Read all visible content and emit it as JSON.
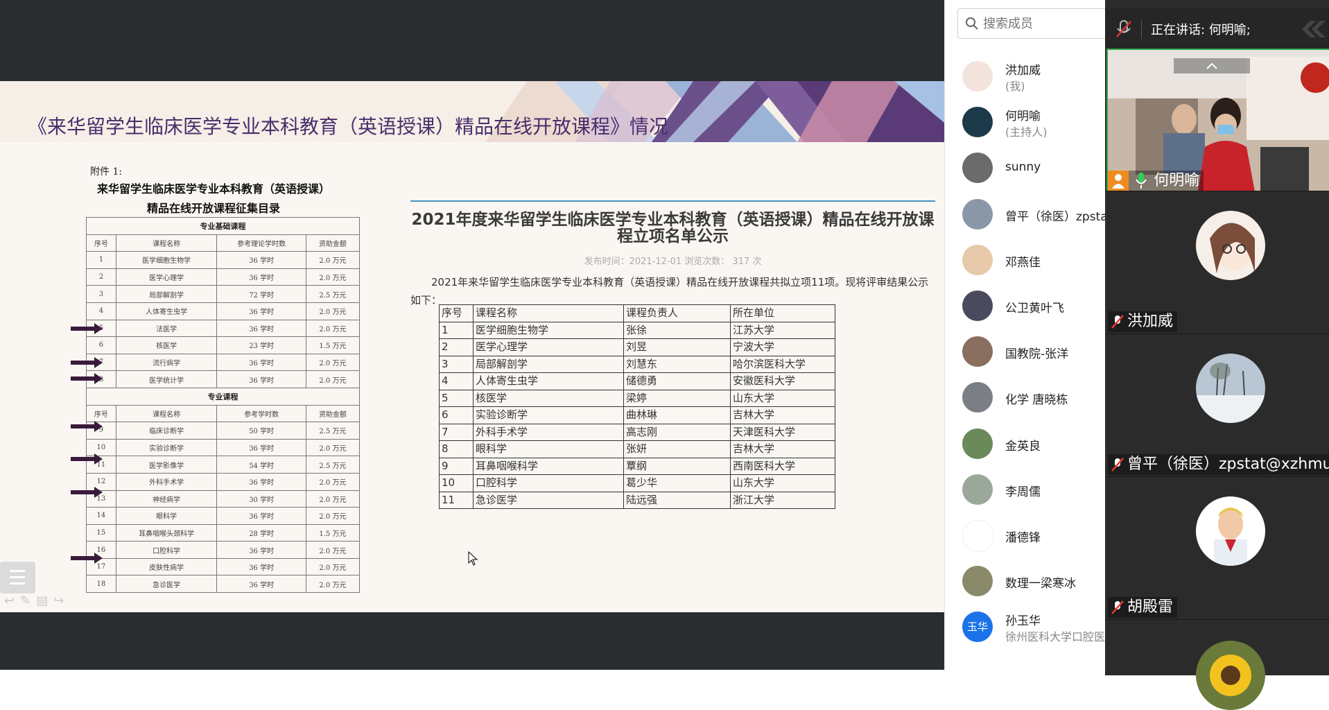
{
  "slide": {
    "title": "《来华留学生临床医学专业本科教育（英语授课）精品在线开放课程》情况"
  },
  "scan": {
    "attachment": "附件 1:",
    "heading1": "来华留学生临床医学专业本科教育（英语授课）",
    "heading2": "精品在线开放课程征集目录",
    "section_basic": "专业基础课程",
    "section_prof": "专业课程",
    "columns": [
      "序号",
      "课程名称",
      "参考理论学时数",
      "资助金额"
    ],
    "basic_rows": [
      [
        "1",
        "医学细胞生物学",
        "36 学时",
        "2.0 万元"
      ],
      [
        "2",
        "医学心理学",
        "36 学时",
        "2.0 万元"
      ],
      [
        "3",
        "局部解剖学",
        "72 学时",
        "2.5 万元"
      ],
      [
        "4",
        "人体寄生虫学",
        "36 学时",
        "2.0 万元"
      ],
      [
        "5",
        "法医学",
        "36 学时",
        "2.0 万元"
      ],
      [
        "6",
        "核医学",
        "23 学时",
        "1.5 万元"
      ],
      [
        "7",
        "流行病学",
        "36 学时",
        "2.0 万元"
      ],
      [
        "8",
        "医学统计学",
        "36 学时",
        "2.0 万元"
      ]
    ],
    "prof_columns": [
      "序号",
      "课程名称",
      "参考学时数",
      "资助金额"
    ],
    "prof_rows": [
      [
        "9",
        "临床诊断学",
        "50 学时",
        "2.5 万元"
      ],
      [
        "10",
        "实验诊断学",
        "36 学时",
        "2.0 万元"
      ],
      [
        "11",
        "医学影像学",
        "54 学时",
        "2.5 万元"
      ],
      [
        "12",
        "外科手术学",
        "36 学时",
        "2.0 万元"
      ],
      [
        "13",
        "神经病学",
        "30 学时",
        "2.0 万元"
      ],
      [
        "14",
        "眼科学",
        "36 学时",
        "2.0 万元"
      ],
      [
        "15",
        "耳鼻咽喉头颈科学",
        "28 学时",
        "1.5 万元"
      ],
      [
        "16",
        "口腔科学",
        "36 学时",
        "2.0 万元"
      ],
      [
        "17",
        "皮肤性病学",
        "36 学时",
        "2.0 万元"
      ],
      [
        "18",
        "急诊医学",
        "36 学时",
        "2.0 万元"
      ]
    ]
  },
  "doc": {
    "title_line1": "2021年度来华留学生临床医学专业本科教育（英语授课）精品在线开放课",
    "title_line2": "程立项名单公示",
    "meta": "发布时间：2021-12-01 浏览次数： 317 次",
    "intro": "2021年来华留学生临床医学专业本科教育（英语授课）精品在线开放课程共拟立项11项。现将评审结果公示如下：",
    "columns": [
      "序号",
      "课程名称",
      "课程负责人",
      "所在单位"
    ],
    "rows": [
      [
        "1",
        "医学细胞生物学",
        "张徐",
        "江苏大学"
      ],
      [
        "2",
        "医学心理学",
        "刘昱",
        "宁波大学"
      ],
      [
        "3",
        "局部解剖学",
        "刘慧东",
        "哈尔滨医科大学"
      ],
      [
        "4",
        "人体寄生虫学",
        "储德勇",
        "安徽医科大学"
      ],
      [
        "5",
        "核医学",
        "梁婷",
        "山东大学"
      ],
      [
        "6",
        "实验诊断学",
        "曲林琳",
        "吉林大学"
      ],
      [
        "7",
        "外科手术学",
        "高志刚",
        "天津医科大学"
      ],
      [
        "8",
        "眼科学",
        "张妍",
        "吉林大学"
      ],
      [
        "9",
        "耳鼻咽喉科学",
        "覃纲",
        "西南医科大学"
      ],
      [
        "10",
        "口腔科学",
        "葛少华",
        "山东大学"
      ],
      [
        "11",
        "急诊医学",
        "陆远强",
        "浙江大学"
      ]
    ]
  },
  "members": {
    "search_placeholder": "搜索成员",
    "list": [
      {
        "name": "洪加威",
        "sub": "(我)",
        "color": "#f2e4dc"
      },
      {
        "name": "何明喻",
        "sub": "(主持人)",
        "color": "#1d3a4a"
      },
      {
        "name": "sunny",
        "sub": "",
        "color": "#6b6b6b"
      },
      {
        "name": "曾平（徐医）zpstat@xzhmu.edu.cn",
        "sub": "",
        "color": "#8a97a8"
      },
      {
        "name": "邓燕佳",
        "sub": "",
        "color": "#e6c9a8"
      },
      {
        "name": "公卫黄叶飞",
        "sub": "",
        "color": "#4a4a5e"
      },
      {
        "name": "国教院-张洋",
        "sub": "",
        "color": "#8a6e5e"
      },
      {
        "name": "化学 唐晓栋",
        "sub": "",
        "color": "#7a7f86"
      },
      {
        "name": "金英良",
        "sub": "",
        "color": "#6a8a5a"
      },
      {
        "name": "李周儒",
        "sub": "",
        "color": "#9aa89a"
      },
      {
        "name": "潘德锋",
        "sub": "",
        "color": "#ffffff"
      },
      {
        "name": "数理一梁寒冰",
        "sub": "",
        "color": "#8a8a6a"
      },
      {
        "name": "孙玉华",
        "sub": "徐州医科大学口腔医学院",
        "color": "#1a73e8",
        "initials": "玉华"
      }
    ]
  },
  "videos": {
    "speaking": "正在讲话: 何明喻;",
    "main_name": "何明喻",
    "tiles": [
      "洪加威",
      "曾平（徐医）zpstat@xzhmu.edu.cn",
      "胡殿雷"
    ]
  }
}
